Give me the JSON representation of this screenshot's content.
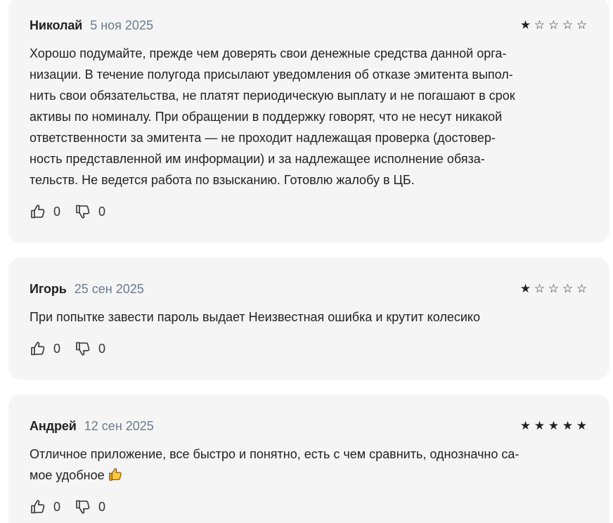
{
  "reviews": [
    {
      "author": "Николай",
      "date": "5 ноя 2025",
      "rating": 1,
      "text": "Хорошо подумайте, прежде чем доверять свои денежные средства данной орга-\nнизации. В течение полугода присылают уведомления об отказе эмитента выпол-\nнить свои обязательства, не платят периодическую выплату и не погашают в срок\nактивы по номиналу. При обращении в поддержку говорят, что не несут никакой\nответственности за эмитента — не проходит надлежащая проверка (достовер-\nность представленной им информации) и за надлежащее исполнение обяза-\nтельств. Не ведется работа по взысканию. Готовлю жалобу в ЦБ.",
      "likes": "0",
      "dislikes": "0"
    },
    {
      "author": "Игорь",
      "date": "25 сен 2025",
      "rating": 1,
      "text": "При попытке завести пароль выдает Неизвестная ошибка и крутит колесико",
      "likes": "0",
      "dislikes": "0"
    },
    {
      "author": "Андрей",
      "date": "12 сен 2025",
      "rating": 5,
      "text": "Отличное приложение, все быстро и понятно, есть с чем сравнить, однозначно са-\nмое удобное",
      "emoji": "thumbs-up-emoji",
      "likes": "0",
      "dislikes": "0"
    }
  ],
  "icons": {
    "filled_star": "★",
    "empty_star": "☆",
    "like": "thumbs-up-icon",
    "dislike": "thumbs-down-icon"
  },
  "colors": {
    "card_background": "#f5f5f5",
    "date_text": "#6b7a8a",
    "primary_text": "#222222"
  }
}
